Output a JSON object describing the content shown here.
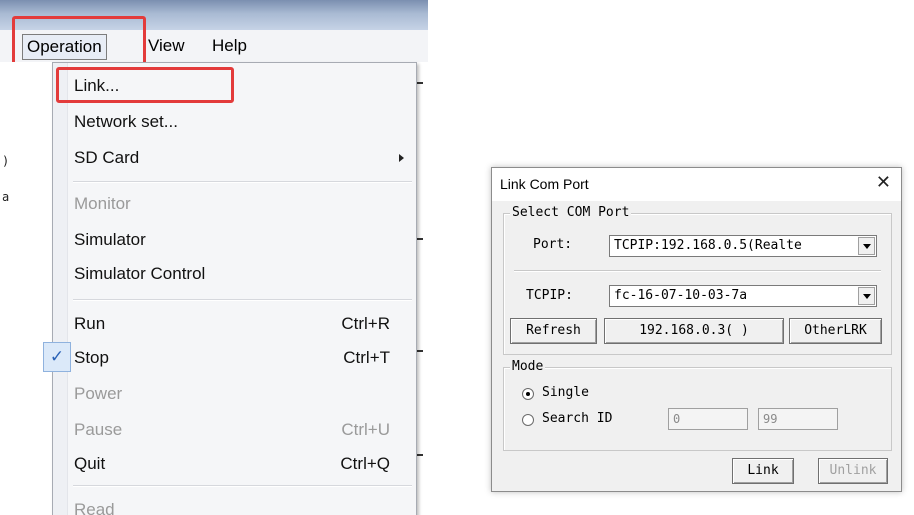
{
  "menubar": {
    "operation": "Operation",
    "view": "View",
    "help": "Help"
  },
  "menu": {
    "items": [
      {
        "label": "Link..."
      },
      {
        "label": "Network set..."
      },
      {
        "label": "SD Card"
      },
      {
        "label": "Monitor"
      },
      {
        "label": "Simulator"
      },
      {
        "label": "Simulator Control"
      },
      {
        "label": "Run",
        "shortcut": "Ctrl+R"
      },
      {
        "label": "Stop",
        "shortcut": "Ctrl+T",
        "checked": true
      },
      {
        "label": "Power"
      },
      {
        "label": "Pause",
        "shortcut": "Ctrl+U"
      },
      {
        "label": "Quit",
        "shortcut": "Ctrl+Q"
      },
      {
        "label": "Read"
      }
    ],
    "check_mark": "✓"
  },
  "highlight_color": "#e33b3b",
  "dialog": {
    "title": "Link Com Port",
    "close": "✕",
    "com_group": "Select COM Port",
    "port_label": "Port:",
    "port_value": "TCPIP:192.168.0.5(Realte",
    "tcpip_label": "TCPIP:",
    "tcpip_value": "fc-16-07-10-03-7a",
    "refresh": "Refresh",
    "ip_button": "192.168.0.3( )",
    "other": "OtherLRK",
    "mode_group": "Mode",
    "single": "Single",
    "search_id": "Search ID",
    "id_from": "0",
    "id_to": "99",
    "link": "Link",
    "unlink": "Unlink"
  }
}
